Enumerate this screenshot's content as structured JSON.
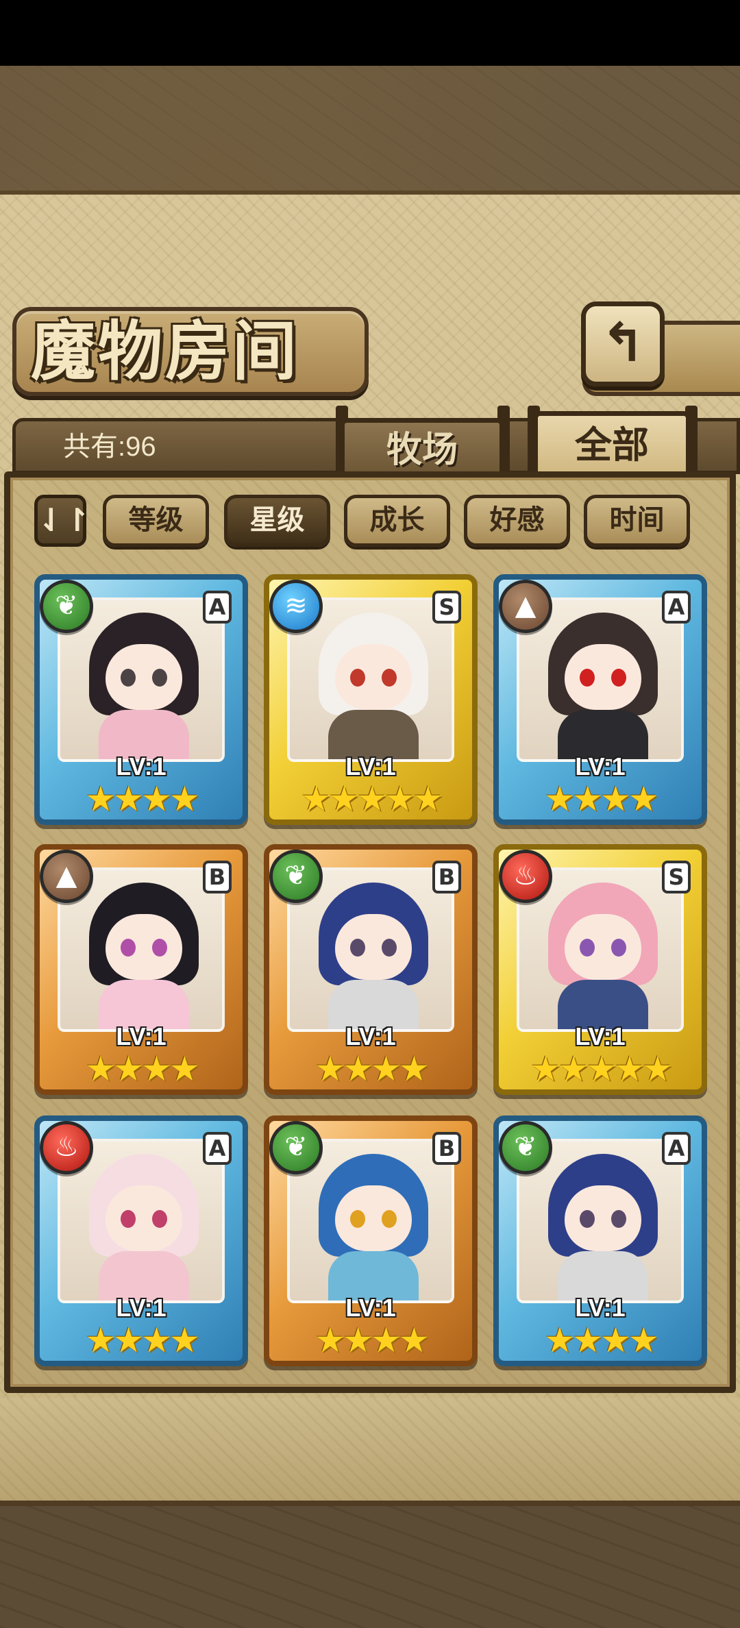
{
  "screen": {
    "title": "魔物房间",
    "back_icon": "back-arrow-icon"
  },
  "tabs": {
    "count_label": "共有:96",
    "ranch": "牧场",
    "all": "全部"
  },
  "sort": {
    "toggle_symbol": "⇃↾",
    "buttons": [
      "等级",
      "星级",
      "成长",
      "好感",
      "时间"
    ],
    "active_index": 1
  },
  "colors": {
    "rarity_A": "#5fb8e0",
    "rarity_S": "#f2cf35",
    "rarity_B": "#e79a3b"
  },
  "monsters": [
    {
      "rarity": "A",
      "element": "leaf",
      "element_glyph": "❦",
      "level": "LV:1",
      "stars": 4,
      "hair": "#2a2226",
      "outfit": "#f1b9c7",
      "eyes": "#4c4444"
    },
    {
      "rarity": "S",
      "element": "water",
      "element_glyph": "≋",
      "level": "LV:1",
      "stars": 5,
      "hair": "#f4f1ec",
      "outfit": "#6a5a48",
      "eyes": "#c0392b"
    },
    {
      "rarity": "A",
      "element": "earth",
      "element_glyph": "▲",
      "level": "LV:1",
      "stars": 4,
      "hair": "#3a2f2c",
      "outfit": "#2b2b2f",
      "eyes": "#d02020"
    },
    {
      "rarity": "B",
      "element": "earth",
      "element_glyph": "▲",
      "level": "LV:1",
      "stars": 4,
      "hair": "#1f1c24",
      "outfit": "#f6c6d6",
      "eyes": "#b04fa8"
    },
    {
      "rarity": "B",
      "element": "leaf",
      "element_glyph": "❦",
      "level": "LV:1",
      "stars": 4,
      "hair": "#2e3f8a",
      "outfit": "#d9d9d9",
      "eyes": "#5a4a6a"
    },
    {
      "rarity": "S",
      "element": "fire",
      "element_glyph": "♨",
      "level": "LV:1",
      "stars": 5,
      "hair": "#f1a7b8",
      "outfit": "#3a4f86",
      "eyes": "#8a57b0"
    },
    {
      "rarity": "A",
      "element": "fire",
      "element_glyph": "♨",
      "level": "LV:1",
      "stars": 4,
      "hair": "#f6dde2",
      "outfit": "#f3c6cf",
      "eyes": "#c0406a"
    },
    {
      "rarity": "B",
      "element": "leaf",
      "element_glyph": "❦",
      "level": "LV:1",
      "stars": 4,
      "hair": "#2f6db8",
      "outfit": "#6fb8d8",
      "eyes": "#e0a020"
    },
    {
      "rarity": "A",
      "element": "leaf",
      "element_glyph": "❦",
      "level": "LV:1",
      "stars": 4,
      "hair": "#2e3f8a",
      "outfit": "#d9d9d9",
      "eyes": "#5a4a6a"
    }
  ]
}
